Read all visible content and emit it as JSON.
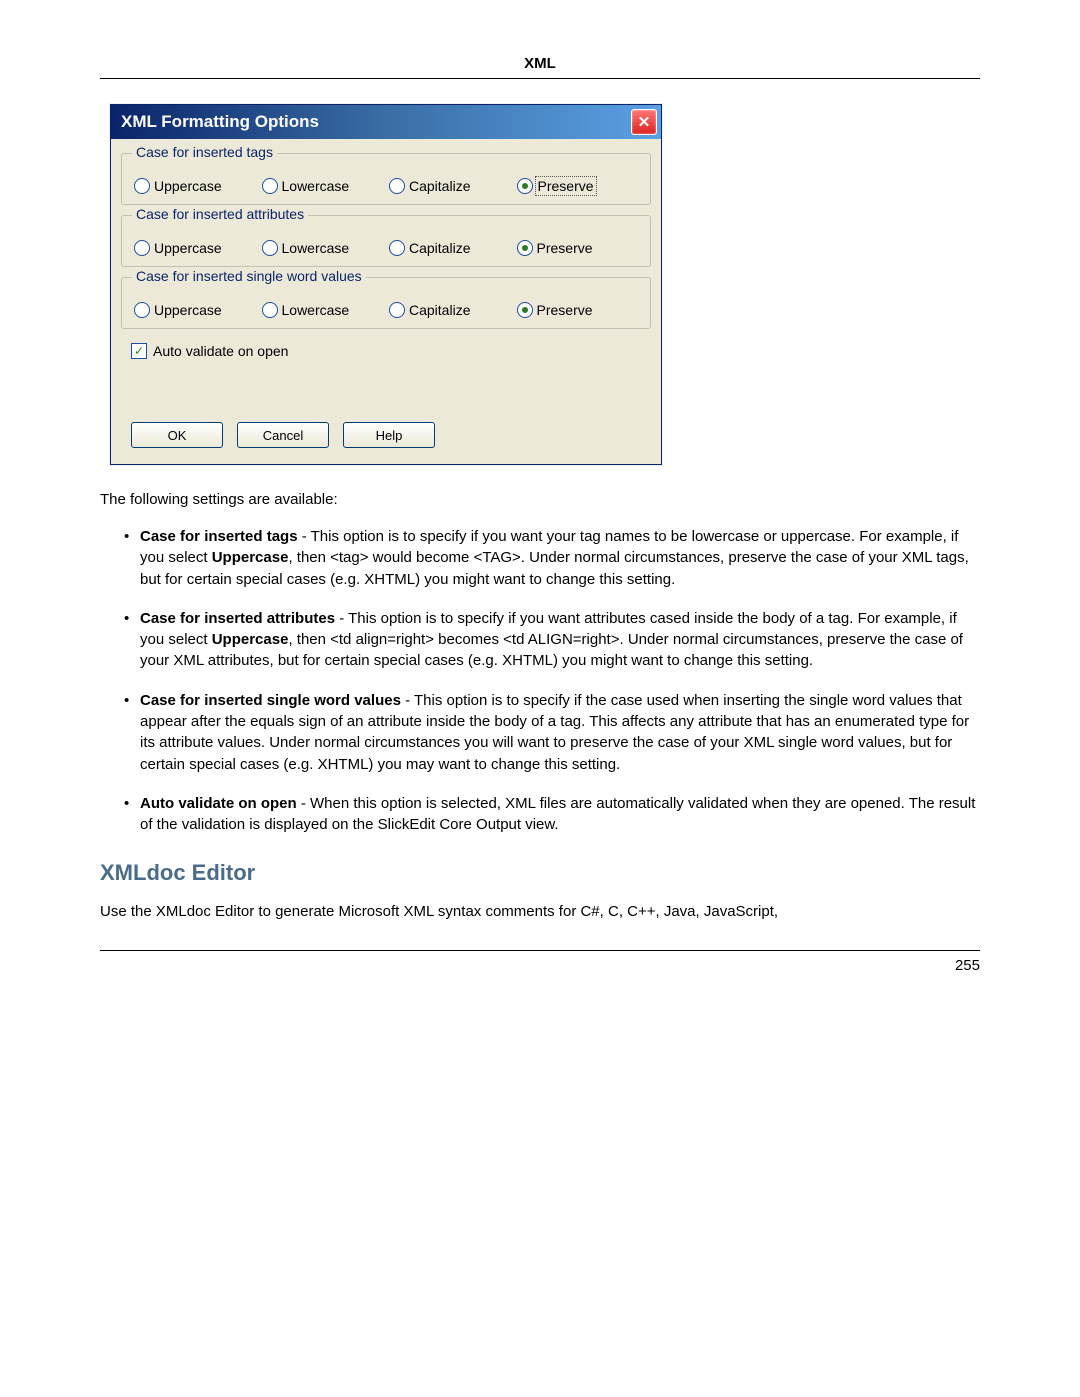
{
  "header": {
    "title": "XML"
  },
  "dialog": {
    "title": "XML Formatting Options",
    "close_label": "✕",
    "groups": {
      "tags": {
        "legend": "Case for inserted tags",
        "options": [
          "Uppercase",
          "Lowercase",
          "Capitalize",
          "Preserve"
        ],
        "selected": 3,
        "focused": true
      },
      "attributes": {
        "legend": "Case for inserted attributes",
        "options": [
          "Uppercase",
          "Lowercase",
          "Capitalize",
          "Preserve"
        ],
        "selected": 3,
        "focused": false
      },
      "values": {
        "legend": "Case for inserted single word values",
        "options": [
          "Uppercase",
          "Lowercase",
          "Capitalize",
          "Preserve"
        ],
        "selected": 3,
        "focused": false
      }
    },
    "checkbox": {
      "label": "Auto validate on open",
      "checked": true
    },
    "buttons": {
      "ok": "OK",
      "cancel": "Cancel",
      "help": "Help"
    }
  },
  "body": {
    "intro": "The following settings are available:",
    "items": {
      "tags": {
        "term": "Case for inserted tags",
        "text": " - This option is to specify if you want your tag names to be lowercase or uppercase. For example, if you select ",
        "bold1": "Uppercase",
        "text2": ", then <tag> would become <TAG>. Under normal circumstances, preserve the case of your XML tags, but for certain special cases (e.g. XHTML) you might want to change this setting."
      },
      "attrs": {
        "term": "Case for inserted attributes",
        "text": " - This option is to specify if you want attributes cased inside the body of a tag. For example, if you select ",
        "bold1": "Uppercase",
        "text2": ", then <td align=right> becomes <td ALIGN=right>. Under normal circumstances, preserve the case of your XML attributes, but for certain special cases (e.g. XHTML) you might want to change this setting."
      },
      "vals": {
        "term": "Case for inserted single word values",
        "text": " - This option is to specify if the case used when inserting the single word values that appear after the equals sign of an attribute inside the body of a tag. This affects any attribute that has an enumerated type for its attribute values. Under normal circumstances you will want to preserve the case of your XML single word values, but for certain special cases (e.g. XHTML) you may want to change this setting."
      },
      "auto": {
        "term": "Auto validate on open",
        "text": " - When this option is selected, XML files are automatically validated when they are opened. The result of the validation is displayed on the SlickEdit Core Output view."
      }
    },
    "section_title": "XMLdoc Editor",
    "section_text": "Use the XMLdoc Editor to generate Microsoft XML syntax comments for C#, C, C++, Java, JavaScript,"
  },
  "page_number": "255"
}
